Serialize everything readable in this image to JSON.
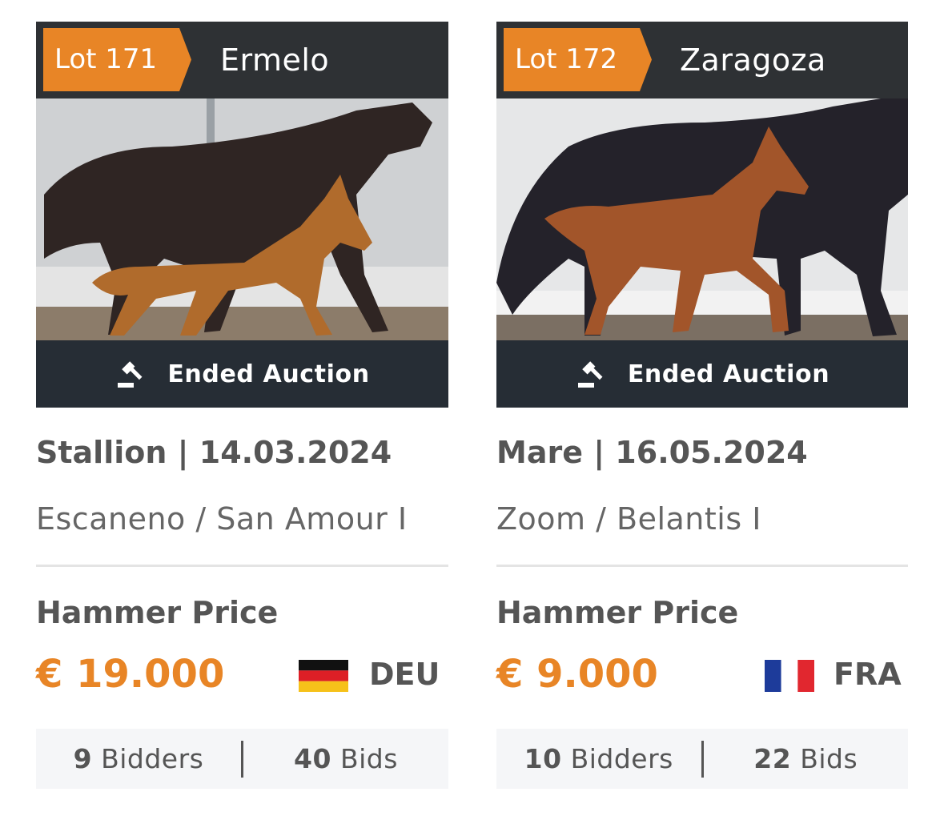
{
  "lots": [
    {
      "lot_label": "Lot 171",
      "name": "Ermelo",
      "status_label": "Ended Auction",
      "gender_date": "Stallion | 14.03.2024",
      "pedigree": "Escaneno / San Amour I",
      "hammer_label": "Hammer Price",
      "price": "€ 19.000",
      "country": "DEU",
      "flag": "germany-flag",
      "bidders_count": "9",
      "bidders_label": "Bidders",
      "bids_count": "40",
      "bids_label": "Bids"
    },
    {
      "lot_label": "Lot 172",
      "name": "Zaragoza",
      "status_label": "Ended Auction",
      "gender_date": "Mare | 16.05.2024",
      "pedigree": "Zoom / Belantis I",
      "hammer_label": "Hammer Price",
      "price": "€ 9.000",
      "country": "FRA",
      "flag": "france-flag",
      "bidders_count": "10",
      "bidders_label": "Bidders",
      "bids_count": "22",
      "bids_label": "Bids"
    }
  ],
  "colors": {
    "accent": "#e88526",
    "header_bg": "#2e3134",
    "status_bg": "#262d35",
    "stats_bg": "#f5f6f8"
  }
}
